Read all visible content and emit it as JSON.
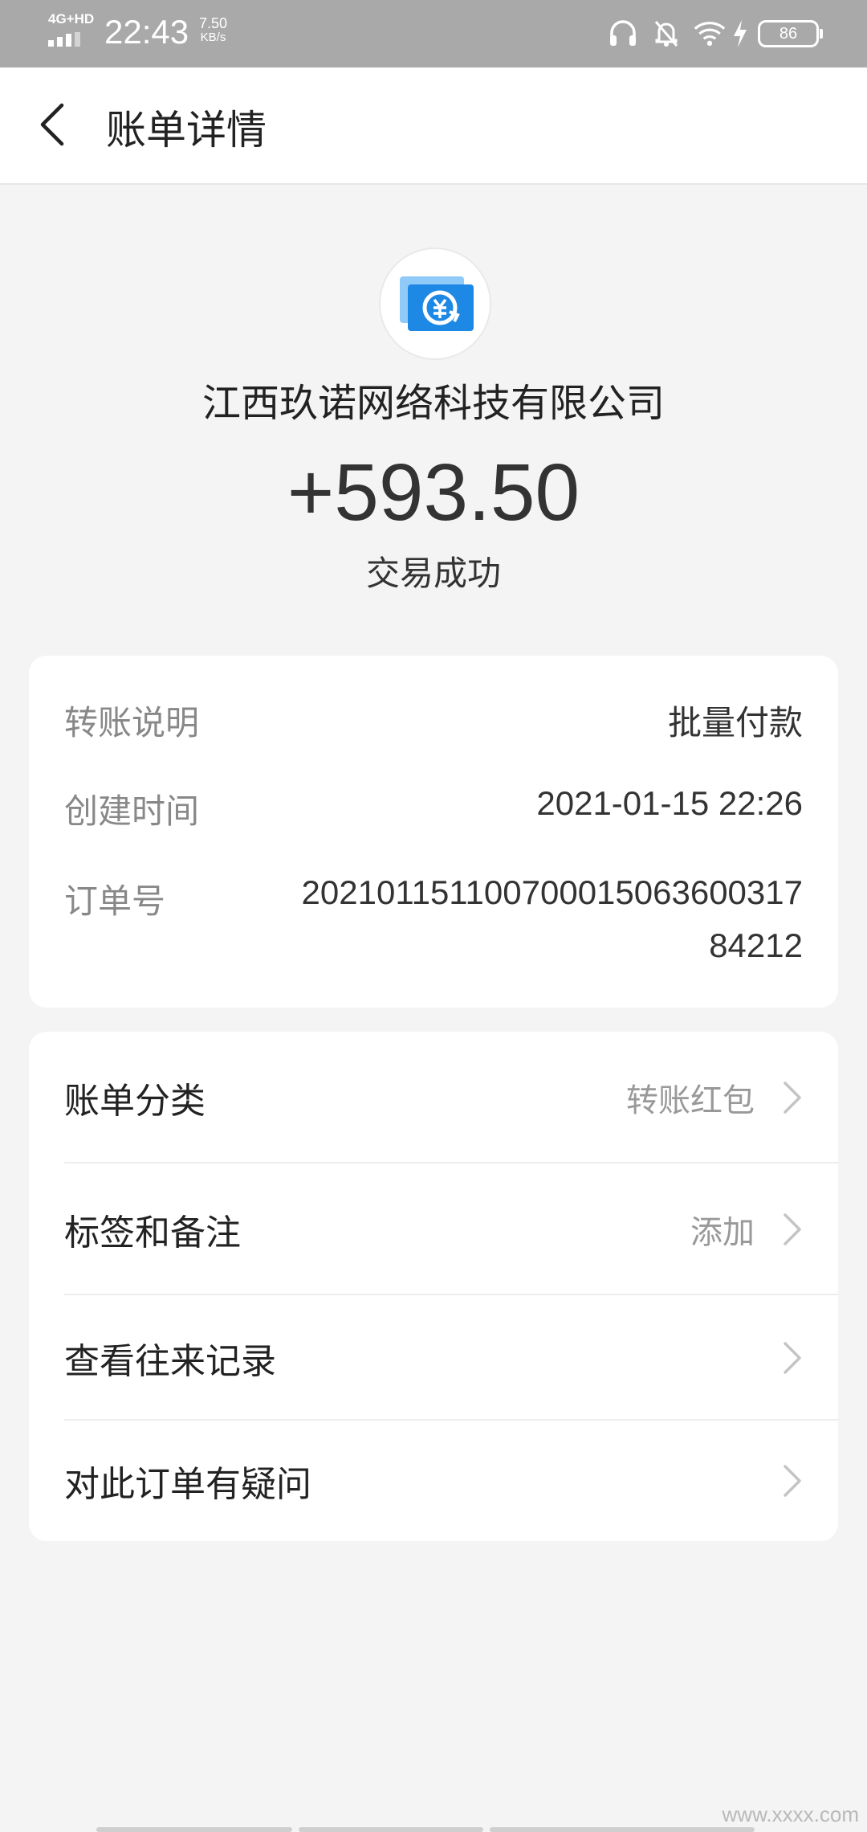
{
  "status_bar": {
    "network": "4G+HD",
    "time": "22:43",
    "speed_value": "7.50",
    "speed_unit": "KB/s",
    "battery": "86",
    "icons": [
      "headphones-icon",
      "mute-bell-icon",
      "wifi-icon",
      "charging-icon"
    ]
  },
  "nav": {
    "title": "账单详情",
    "back_icon": "chevron-left-icon"
  },
  "header": {
    "merchant_name": "江西玖诺网络科技有限公司",
    "amount": "+593.50",
    "status": "交易成功",
    "logo_icon": "transfer-yuan-icon",
    "logo_colors": {
      "primary": "#1e88e5",
      "light": "#90caf9"
    }
  },
  "info": {
    "rows": [
      {
        "label": "转账说明",
        "value": "批量付款"
      },
      {
        "label": "创建时间",
        "value": "2021-01-15 22:26"
      },
      {
        "label": "订单号",
        "value": "2021011511007000150636003178 4212"
      }
    ],
    "order_no_line1": "202101151100700015063600317",
    "order_no_line2": "84212"
  },
  "actions": [
    {
      "label": "账单分类",
      "value": "转账红包"
    },
    {
      "label": "标签和备注",
      "value": "添加"
    },
    {
      "label": "查看往来记录",
      "value": ""
    },
    {
      "label": "对此订单有疑问",
      "value": ""
    }
  ],
  "watermark": "www.xxxx.com"
}
